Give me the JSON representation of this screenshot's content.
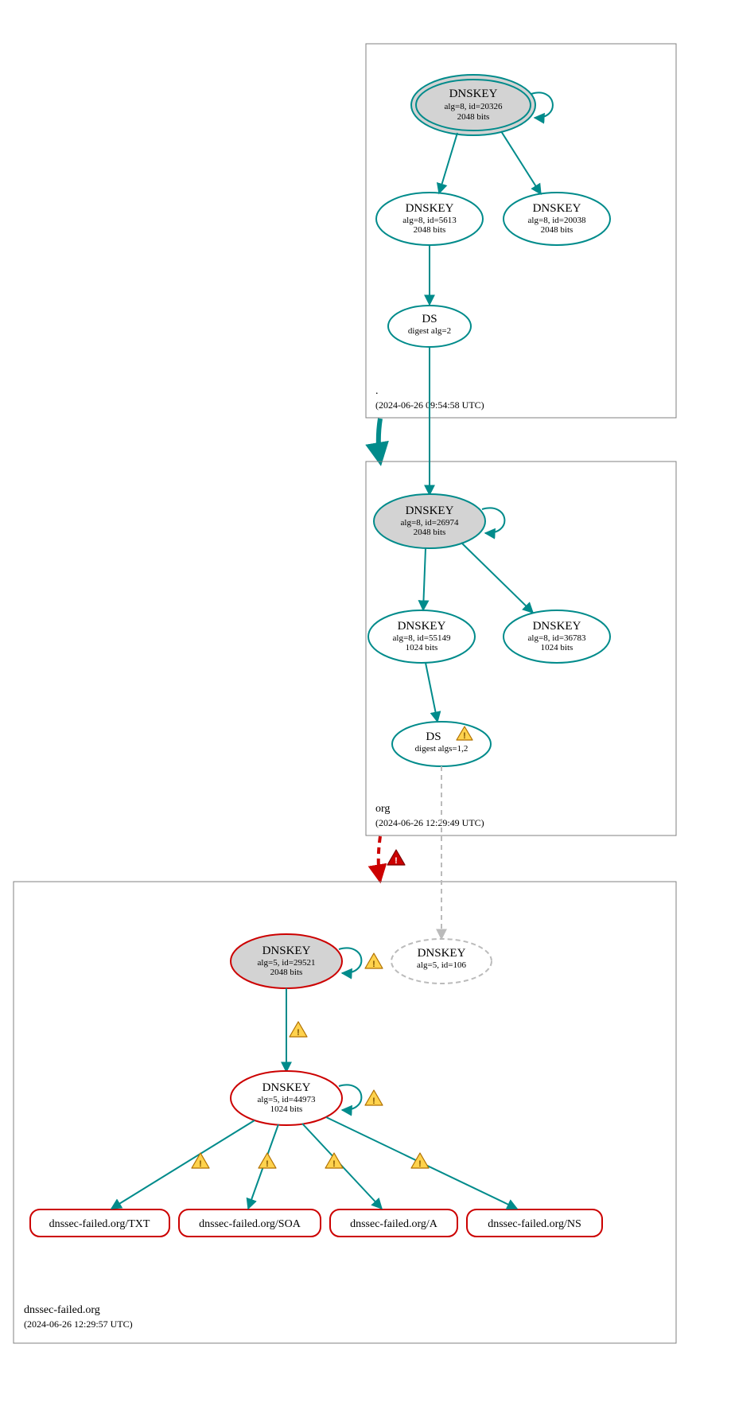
{
  "zones": {
    "root": {
      "name": ".",
      "timestamp": "(2024-06-26 09:54:58 UTC)"
    },
    "org": {
      "name": "org",
      "timestamp": "(2024-06-26 12:29:49 UTC)"
    },
    "failed": {
      "name": "dnssec-failed.org",
      "timestamp": "(2024-06-26 12:29:57 UTC)"
    }
  },
  "nodes": {
    "root_ksk": {
      "title": "DNSKEY",
      "line1": "alg=8, id=20326",
      "line2": "2048 bits"
    },
    "root_zsk1": {
      "title": "DNSKEY",
      "line1": "alg=8, id=5613",
      "line2": "2048 bits"
    },
    "root_zsk2": {
      "title": "DNSKEY",
      "line1": "alg=8, id=20038",
      "line2": "2048 bits"
    },
    "root_ds": {
      "title": "DS",
      "line1": "digest alg=2",
      "line2": ""
    },
    "org_ksk": {
      "title": "DNSKEY",
      "line1": "alg=8, id=26974",
      "line2": "2048 bits"
    },
    "org_zsk1": {
      "title": "DNSKEY",
      "line1": "alg=8, id=55149",
      "line2": "1024 bits"
    },
    "org_zsk2": {
      "title": "DNSKEY",
      "line1": "alg=8, id=36783",
      "line2": "1024 bits"
    },
    "org_ds": {
      "title": "DS",
      "line1": "digest algs=1,2",
      "line2": ""
    },
    "fail_ksk": {
      "title": "DNSKEY",
      "line1": "alg=5, id=29521",
      "line2": "2048 bits"
    },
    "fail_zsk": {
      "title": "DNSKEY",
      "line1": "alg=5, id=44973",
      "line2": "1024 bits"
    },
    "fail_gray": {
      "title": "DNSKEY",
      "line1": "alg=5, id=106",
      "line2": ""
    }
  },
  "rrsets": {
    "txt": "dnssec-failed.org/TXT",
    "soa": "dnssec-failed.org/SOA",
    "a": "dnssec-failed.org/A",
    "ns": "dnssec-failed.org/NS"
  }
}
